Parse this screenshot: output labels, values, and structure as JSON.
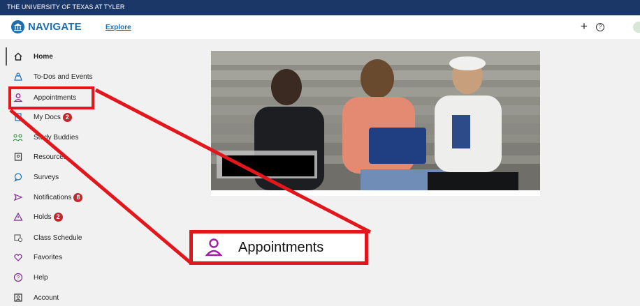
{
  "topbar": {
    "university": "THE UNIVERSITY OF TEXAS AT TYLER"
  },
  "header": {
    "brand": "NAVIGATE",
    "explore": "Explore",
    "add_icon": "plus-icon",
    "help_icon": "help-icon"
  },
  "sidebar": {
    "items": [
      {
        "label": "Home",
        "icon": "home-icon"
      },
      {
        "label": "To-Dos and Events",
        "icon": "to-dos-icon"
      },
      {
        "label": "Appointments",
        "icon": "person-icon"
      },
      {
        "label": "My Docs",
        "icon": "docs-icon",
        "badge": "2"
      },
      {
        "label": "Study Buddies",
        "icon": "study-buddies-icon"
      },
      {
        "label": "Resources",
        "icon": "resources-icon"
      },
      {
        "label": "Surveys",
        "icon": "chat-bubble-icon"
      },
      {
        "label": "Notifications",
        "icon": "send-icon",
        "badge": "8"
      },
      {
        "label": "Holds",
        "icon": "warning-icon",
        "badge": "2"
      },
      {
        "label": "Class Schedule",
        "icon": "schedule-icon"
      },
      {
        "label": "Favorites",
        "icon": "heart-icon"
      },
      {
        "label": "Help",
        "icon": "help-icon"
      },
      {
        "label": "Account",
        "icon": "account-icon"
      }
    ]
  },
  "callout": {
    "label": "Appointments",
    "icon": "person-icon"
  },
  "colors": {
    "brand_blue": "#1a6fb3",
    "topbar": "#1b3767",
    "highlight": "#e3161b",
    "badge": "#c0282d",
    "appointments_icon": "#a020a0"
  }
}
